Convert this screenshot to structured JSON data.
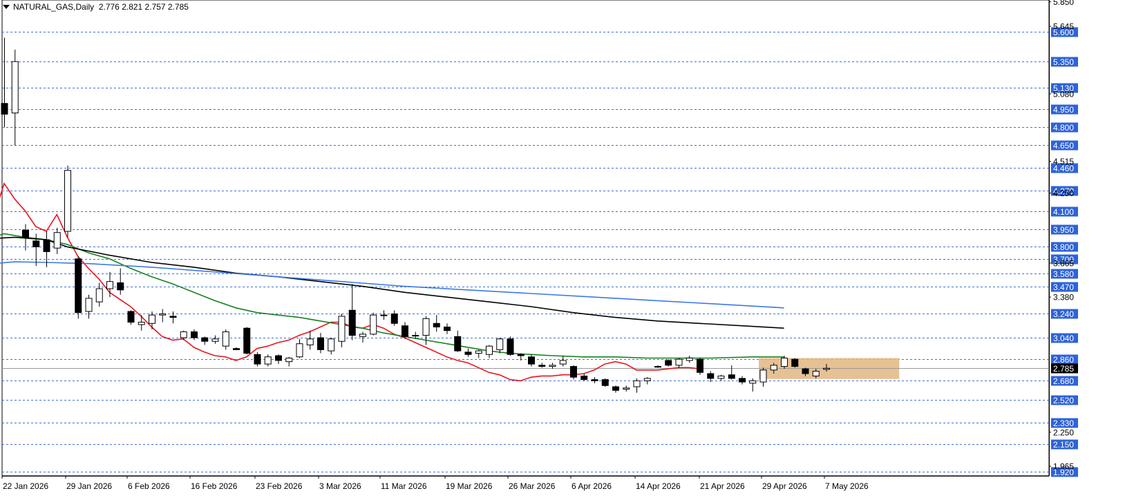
{
  "header": {
    "symbol": "NATURAL_GAS",
    "timeframe": "Daily",
    "ohlc": "2.776 2.821 2.757 2.785",
    "separator": ","
  },
  "colors": {
    "background": "#ffffff",
    "grid": "#3b6fd6",
    "label_bg": "#2e63d8",
    "label_text": "#ffffff",
    "candle_bull_fill": "#ffffff",
    "candle_bear_fill": "#000000",
    "ma_fast": "#e8141c",
    "ma_mid": "#16801e",
    "ma_slow": "#000000",
    "ma_long": "#3b78e7",
    "zone": "#e2b680",
    "current_price_line": "#9a9a9a"
  },
  "chart_data": {
    "type": "candlestick",
    "title": "NATURAL_GAS,Daily",
    "ylim": [
      1.885,
      5.865
    ],
    "grid": true,
    "x_tick_labels": [
      "22 Jan 2026",
      "29 Jan 2026",
      "6 Feb 2026",
      "16 Feb 2026",
      "23 Feb 2026",
      "3 Mar 2026",
      "11 Mar 2026",
      "19 Mar 2026",
      "26 Mar 2026",
      "6 Apr 2026",
      "14 Apr 2026",
      "21 Apr 2026",
      "29 Apr 2026",
      "7 May 2026"
    ],
    "scale_labels": [
      "5.850",
      "5.645",
      "5.080",
      "4.515",
      "4.250",
      "3.665",
      "3.380",
      "2.250",
      "1.965"
    ],
    "level_labels": [
      "5.600",
      "5.350",
      "5.130",
      "4.950",
      "4.800",
      "4.650",
      "4.460",
      "4.270",
      "4.100",
      "3.950",
      "3.800",
      "3.700",
      "3.580",
      "3.470",
      "3.240",
      "3.040",
      "2.860",
      "2.680",
      "2.520",
      "2.330",
      "2.150",
      "1.920"
    ],
    "current_price": "2.785",
    "zone": {
      "from_index": 72,
      "to_index": 81,
      "high": 2.87,
      "low": 2.695
    },
    "candles": [
      {
        "o": 5.0,
        "h": 5.55,
        "l": 4.8,
        "c": 4.91
      },
      {
        "o": 4.92,
        "h": 5.45,
        "l": 4.65,
        "c": 5.35
      },
      {
        "o": 3.94,
        "h": 3.99,
        "l": 3.77,
        "c": 3.88
      },
      {
        "o": 3.85,
        "h": 3.91,
        "l": 3.64,
        "c": 3.8
      },
      {
        "o": 3.86,
        "h": 3.93,
        "l": 3.63,
        "c": 3.76
      },
      {
        "o": 3.79,
        "h": 3.96,
        "l": 3.74,
        "c": 3.92
      },
      {
        "o": 3.93,
        "h": 4.48,
        "l": 3.88,
        "c": 4.44
      },
      {
        "o": 3.7,
        "h": 3.72,
        "l": 3.2,
        "c": 3.25
      },
      {
        "o": 3.26,
        "h": 3.4,
        "l": 3.2,
        "c": 3.37
      },
      {
        "o": 3.34,
        "h": 3.5,
        "l": 3.3,
        "c": 3.45
      },
      {
        "o": 3.45,
        "h": 3.59,
        "l": 3.38,
        "c": 3.51
      },
      {
        "o": 3.5,
        "h": 3.62,
        "l": 3.4,
        "c": 3.44
      },
      {
        "o": 3.26,
        "h": 3.27,
        "l": 3.15,
        "c": 3.17
      },
      {
        "o": 3.15,
        "h": 3.23,
        "l": 3.1,
        "c": 3.17
      },
      {
        "o": 3.16,
        "h": 3.26,
        "l": 3.11,
        "c": 3.23
      },
      {
        "o": 3.23,
        "h": 3.28,
        "l": 3.17,
        "c": 3.24
      },
      {
        "o": 3.22,
        "h": 3.26,
        "l": 3.16,
        "c": 3.21
      },
      {
        "o": 3.04,
        "h": 3.1,
        "l": 3.02,
        "c": 3.09
      },
      {
        "o": 3.09,
        "h": 3.11,
        "l": 3.02,
        "c": 3.04
      },
      {
        "o": 3.04,
        "h": 3.05,
        "l": 2.98,
        "c": 3.01
      },
      {
        "o": 3.01,
        "h": 3.06,
        "l": 2.99,
        "c": 3.03
      },
      {
        "o": 2.97,
        "h": 3.11,
        "l": 2.94,
        "c": 3.09
      },
      {
        "o": 2.95,
        "h": 2.96,
        "l": 2.94,
        "c": 2.94
      },
      {
        "o": 3.12,
        "h": 3.13,
        "l": 2.9,
        "c": 2.91
      },
      {
        "o": 2.9,
        "h": 2.92,
        "l": 2.8,
        "c": 2.82
      },
      {
        "o": 2.82,
        "h": 2.9,
        "l": 2.8,
        "c": 2.88
      },
      {
        "o": 2.89,
        "h": 2.9,
        "l": 2.82,
        "c": 2.85
      },
      {
        "o": 2.84,
        "h": 2.88,
        "l": 2.8,
        "c": 2.87
      },
      {
        "o": 2.88,
        "h": 3.03,
        "l": 2.87,
        "c": 2.99
      },
      {
        "o": 2.98,
        "h": 3.1,
        "l": 2.94,
        "c": 3.03
      },
      {
        "o": 3.04,
        "h": 3.08,
        "l": 2.91,
        "c": 2.94
      },
      {
        "o": 2.93,
        "h": 3.04,
        "l": 2.9,
        "c": 3.03
      },
      {
        "o": 3.01,
        "h": 3.24,
        "l": 2.96,
        "c": 3.22
      },
      {
        "o": 3.27,
        "h": 3.49,
        "l": 3.02,
        "c": 3.06
      },
      {
        "o": 3.05,
        "h": 3.09,
        "l": 3.0,
        "c": 3.07
      },
      {
        "o": 3.07,
        "h": 3.25,
        "l": 3.06,
        "c": 3.23
      },
      {
        "o": 3.23,
        "h": 3.27,
        "l": 3.19,
        "c": 3.23
      },
      {
        "o": 3.24,
        "h": 3.27,
        "l": 3.14,
        "c": 3.16
      },
      {
        "o": 3.14,
        "h": 3.17,
        "l": 3.03,
        "c": 3.05
      },
      {
        "o": 3.06,
        "h": 3.09,
        "l": 3.03,
        "c": 3.06
      },
      {
        "o": 3.06,
        "h": 3.22,
        "l": 2.98,
        "c": 3.2
      },
      {
        "o": 3.16,
        "h": 3.23,
        "l": 3.09,
        "c": 3.13
      },
      {
        "o": 3.13,
        "h": 3.16,
        "l": 3.07,
        "c": 3.1
      },
      {
        "o": 3.05,
        "h": 3.1,
        "l": 2.92,
        "c": 2.93
      },
      {
        "o": 2.92,
        "h": 2.95,
        "l": 2.88,
        "c": 2.9
      },
      {
        "o": 2.91,
        "h": 2.94,
        "l": 2.87,
        "c": 2.93
      },
      {
        "o": 2.9,
        "h": 2.98,
        "l": 2.87,
        "c": 2.97
      },
      {
        "o": 2.94,
        "h": 3.04,
        "l": 2.91,
        "c": 3.03
      },
      {
        "o": 3.03,
        "h": 3.05,
        "l": 2.89,
        "c": 2.9
      },
      {
        "o": 2.9,
        "h": 2.91,
        "l": 2.85,
        "c": 2.89
      },
      {
        "o": 2.88,
        "h": 2.9,
        "l": 2.8,
        "c": 2.82
      },
      {
        "o": 2.81,
        "h": 2.83,
        "l": 2.79,
        "c": 2.8
      },
      {
        "o": 2.8,
        "h": 2.83,
        "l": 2.78,
        "c": 2.81
      },
      {
        "o": 2.82,
        "h": 2.89,
        "l": 2.8,
        "c": 2.85
      },
      {
        "o": 2.8,
        "h": 2.81,
        "l": 2.69,
        "c": 2.71
      },
      {
        "o": 2.72,
        "h": 2.74,
        "l": 2.68,
        "c": 2.69
      },
      {
        "o": 2.69,
        "h": 2.71,
        "l": 2.66,
        "c": 2.68
      },
      {
        "o": 2.69,
        "h": 2.7,
        "l": 2.63,
        "c": 2.64
      },
      {
        "o": 2.63,
        "h": 2.64,
        "l": 2.58,
        "c": 2.6
      },
      {
        "o": 2.61,
        "h": 2.64,
        "l": 2.59,
        "c": 2.62
      },
      {
        "o": 2.63,
        "h": 2.7,
        "l": 2.58,
        "c": 2.68
      },
      {
        "o": 2.68,
        "h": 2.71,
        "l": 2.65,
        "c": 2.7
      },
      {
        "o": 2.8,
        "h": 2.81,
        "l": 2.79,
        "c": 2.8
      },
      {
        "o": 2.85,
        "h": 2.86,
        "l": 2.8,
        "c": 2.81
      },
      {
        "o": 2.81,
        "h": 2.87,
        "l": 2.79,
        "c": 2.86
      },
      {
        "o": 2.85,
        "h": 2.89,
        "l": 2.83,
        "c": 2.87
      },
      {
        "o": 2.86,
        "h": 2.87,
        "l": 2.73,
        "c": 2.75
      },
      {
        "o": 2.74,
        "h": 2.76,
        "l": 2.67,
        "c": 2.7
      },
      {
        "o": 2.7,
        "h": 2.73,
        "l": 2.68,
        "c": 2.72
      },
      {
        "o": 2.73,
        "h": 2.81,
        "l": 2.69,
        "c": 2.7
      },
      {
        "o": 2.7,
        "h": 2.72,
        "l": 2.65,
        "c": 2.67
      },
      {
        "o": 2.66,
        "h": 2.7,
        "l": 2.59,
        "c": 2.68
      },
      {
        "o": 2.67,
        "h": 2.79,
        "l": 2.63,
        "c": 2.77
      },
      {
        "o": 2.77,
        "h": 2.83,
        "l": 2.74,
        "c": 2.81
      },
      {
        "o": 2.8,
        "h": 2.89,
        "l": 2.78,
        "c": 2.87
      },
      {
        "o": 2.86,
        "h": 2.87,
        "l": 2.79,
        "c": 2.8
      },
      {
        "o": 2.78,
        "h": 2.79,
        "l": 2.72,
        "c": 2.74
      },
      {
        "o": 2.72,
        "h": 2.78,
        "l": 2.7,
        "c": 2.76
      },
      {
        "o": 2.776,
        "h": 2.821,
        "l": 2.757,
        "c": 2.785
      }
    ],
    "series": [
      {
        "color": "#e8141c",
        "points": [
          [
            -1,
            4.05
          ],
          [
            0,
            4.33
          ],
          [
            1,
            4.2
          ],
          [
            2,
            4.1
          ],
          [
            3,
            3.97
          ],
          [
            4,
            3.93
          ],
          [
            5,
            4.07
          ],
          [
            6,
            3.88
          ],
          [
            7,
            3.72
          ],
          [
            8,
            3.62
          ],
          [
            9,
            3.53
          ],
          [
            10,
            3.42
          ],
          [
            11,
            3.36
          ],
          [
            12,
            3.3
          ],
          [
            13,
            3.22
          ],
          [
            14,
            3.13
          ],
          [
            15,
            3.05
          ],
          [
            16,
            3.02
          ],
          [
            17,
            3.03
          ],
          [
            18,
            2.96
          ],
          [
            19,
            2.92
          ],
          [
            20,
            2.89
          ],
          [
            21,
            2.88
          ],
          [
            22,
            2.85
          ],
          [
            23,
            2.88
          ],
          [
            24,
            2.95
          ],
          [
            25,
            2.97
          ],
          [
            26,
            3.0
          ],
          [
            27,
            3.02
          ],
          [
            28,
            3.06
          ],
          [
            29,
            3.09
          ],
          [
            30,
            3.13
          ],
          [
            31,
            3.17
          ],
          [
            32,
            3.17
          ],
          [
            33,
            3.13
          ],
          [
            34,
            3.12
          ],
          [
            35,
            3.15
          ],
          [
            36,
            3.12
          ],
          [
            37,
            3.07
          ],
          [
            38,
            3.04
          ],
          [
            39,
            3.0
          ],
          [
            40,
            2.96
          ],
          [
            41,
            2.92
          ],
          [
            42,
            2.88
          ],
          [
            43,
            2.85
          ],
          [
            44,
            2.83
          ],
          [
            45,
            2.79
          ],
          [
            46,
            2.75
          ],
          [
            47,
            2.73
          ],
          [
            48,
            2.69
          ],
          [
            49,
            2.68
          ],
          [
            50,
            2.71
          ],
          [
            51,
            2.72
          ],
          [
            52,
            2.72
          ],
          [
            53,
            2.73
          ],
          [
            54,
            2.73
          ],
          [
            55,
            2.74
          ],
          [
            56,
            2.77
          ],
          [
            57,
            2.82
          ],
          [
            58,
            2.84
          ],
          [
            59,
            2.82
          ],
          [
            60,
            2.77
          ],
          [
            61,
            2.77
          ],
          [
            62,
            2.77
          ],
          [
            63,
            2.78
          ],
          [
            64,
            2.79
          ],
          [
            65,
            2.79
          ],
          [
            66,
            2.78
          ]
        ]
      },
      {
        "color": "#16801e",
        "points": [
          [
            -1,
            3.88
          ],
          [
            0,
            3.91
          ],
          [
            2,
            3.88
          ],
          [
            4,
            3.86
          ],
          [
            6,
            3.82
          ],
          [
            8,
            3.75
          ],
          [
            10,
            3.7
          ],
          [
            12,
            3.62
          ],
          [
            14,
            3.55
          ],
          [
            16,
            3.49
          ],
          [
            18,
            3.42
          ],
          [
            20,
            3.35
          ],
          [
            22,
            3.29
          ],
          [
            24,
            3.25
          ],
          [
            26,
            3.23
          ],
          [
            28,
            3.21
          ],
          [
            30,
            3.18
          ],
          [
            32,
            3.15
          ],
          [
            34,
            3.12
          ],
          [
            36,
            3.08
          ],
          [
            38,
            3.05
          ],
          [
            40,
            3.02
          ],
          [
            42,
            2.99
          ],
          [
            44,
            2.96
          ],
          [
            46,
            2.93
          ],
          [
            48,
            2.91
          ],
          [
            50,
            2.9
          ],
          [
            52,
            2.89
          ],
          [
            55,
            2.88
          ],
          [
            58,
            2.88
          ],
          [
            61,
            2.87
          ],
          [
            64,
            2.87
          ],
          [
            67,
            2.87
          ],
          [
            71,
            2.88
          ],
          [
            74,
            2.88
          ]
        ]
      },
      {
        "color": "#000000",
        "points": [
          [
            -1,
            3.87
          ],
          [
            1,
            3.88
          ],
          [
            4,
            3.86
          ],
          [
            6,
            3.8
          ],
          [
            10,
            3.73
          ],
          [
            14,
            3.67
          ],
          [
            18,
            3.63
          ],
          [
            22,
            3.58
          ],
          [
            26,
            3.55
          ],
          [
            30,
            3.51
          ],
          [
            34,
            3.47
          ],
          [
            38,
            3.42
          ],
          [
            42,
            3.38
          ],
          [
            46,
            3.34
          ],
          [
            50,
            3.3
          ],
          [
            54,
            3.25
          ],
          [
            58,
            3.21
          ],
          [
            62,
            3.18
          ],
          [
            66,
            3.16
          ],
          [
            70,
            3.14
          ],
          [
            74,
            3.12
          ]
        ]
      },
      {
        "color": "#3b78e7",
        "points": [
          [
            -1,
            3.66
          ],
          [
            1,
            3.675
          ],
          [
            4,
            3.67
          ],
          [
            8,
            3.66
          ],
          [
            14,
            3.63
          ],
          [
            20,
            3.59
          ],
          [
            26,
            3.55
          ],
          [
            32,
            3.51
          ],
          [
            38,
            3.47
          ],
          [
            44,
            3.44
          ],
          [
            50,
            3.41
          ],
          [
            56,
            3.38
          ],
          [
            62,
            3.35
          ],
          [
            68,
            3.32
          ],
          [
            74,
            3.29
          ]
        ]
      }
    ]
  }
}
